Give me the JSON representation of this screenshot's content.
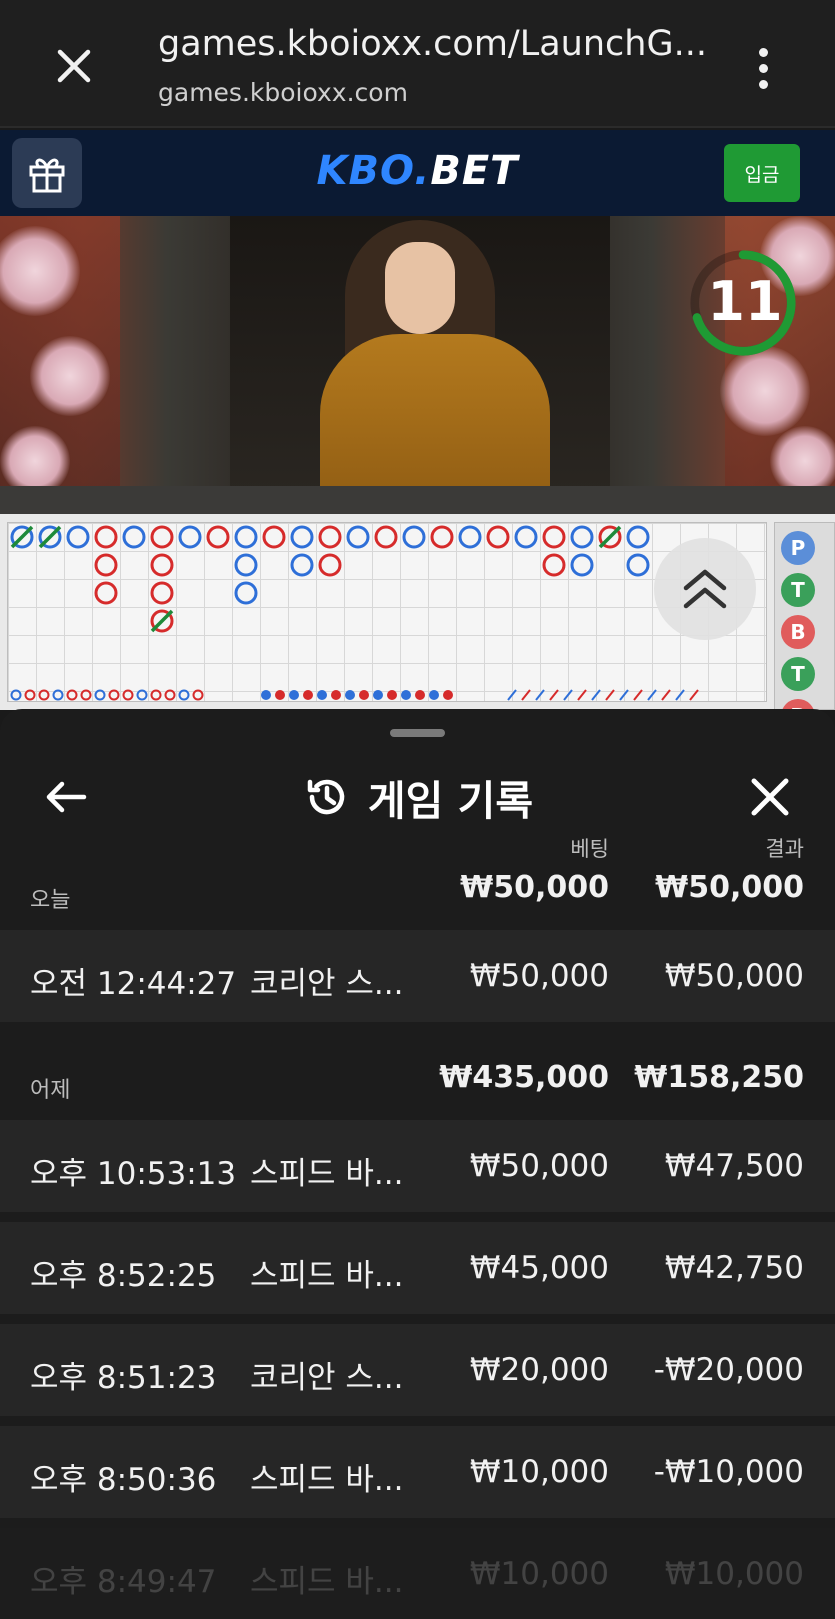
{
  "browser": {
    "url": "games.kboioxx.com/LaunchG...",
    "domain": "games.kboioxx.com"
  },
  "site": {
    "logo_kbo": "KBO.",
    "logo_bet": "BET",
    "deposit_label": "입금"
  },
  "video": {
    "timer_value": "11",
    "timer_fraction": 0.7
  },
  "roadmap": {
    "side_tags": [
      "P",
      "T",
      "B",
      "T",
      "B"
    ]
  },
  "history": {
    "title": "게임 기록",
    "col_bet": "베팅",
    "col_result": "결과",
    "groups": [
      {
        "label": "오늘",
        "bet_total": "₩50,000",
        "result_total": "₩50,000",
        "rows": [
          {
            "time": "오전 12:44:27",
            "game": "코리안 스...",
            "bet": "₩50,000",
            "result": "₩50,000"
          }
        ]
      },
      {
        "label": "어제",
        "bet_total": "₩435,000",
        "result_total": "₩158,250",
        "rows": [
          {
            "time": "오후 10:53:13",
            "game": "스피드 바...",
            "bet": "₩50,000",
            "result": "₩47,500"
          },
          {
            "time": "오후 8:52:25",
            "game": "스피드 바...",
            "bet": "₩45,000",
            "result": "₩42,750"
          },
          {
            "time": "오후 8:51:23",
            "game": "코리안 스...",
            "bet": "₩20,000",
            "result": "-₩20,000"
          },
          {
            "time": "오후 8:50:36",
            "game": "스피드 바...",
            "bet": "₩10,000",
            "result": "-₩10,000"
          },
          {
            "time": "오후 8:49:47",
            "game": "스피드 바...",
            "bet": "₩10,000",
            "result": "₩10,000"
          }
        ]
      }
    ]
  },
  "colors": {
    "player": "#2e6fd8",
    "banker": "#d62b2b",
    "tie": "#1e8a3a",
    "deposit": "#1f9a34",
    "logo_blue": "#2f86ff"
  }
}
